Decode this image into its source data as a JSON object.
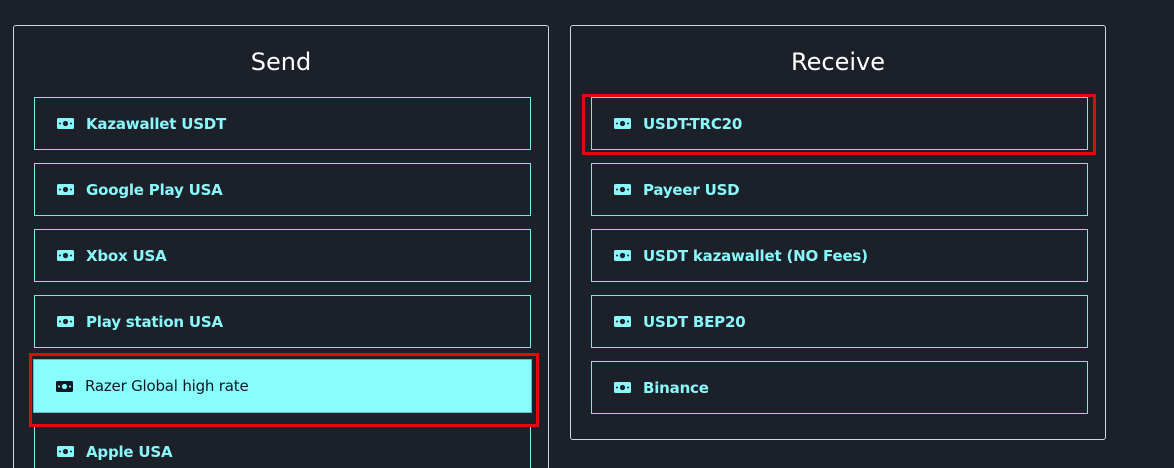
{
  "send": {
    "title": "Send",
    "items": [
      {
        "label": "Kazawallet USDT",
        "selected": false
      },
      {
        "label": "Google Play USA",
        "selected": false
      },
      {
        "label": "Xbox USA",
        "selected": false
      },
      {
        "label": "Play station USA",
        "selected": false
      },
      {
        "label": "Razer Global high rate",
        "selected": true
      },
      {
        "label": "Apple USA",
        "selected": false
      }
    ]
  },
  "receive": {
    "title": "Receive",
    "items": [
      {
        "label": "USDT-TRC20",
        "selected": false
      },
      {
        "label": "Payeer USD",
        "selected": false
      },
      {
        "label": "USDT kazawallet (NO Fees)",
        "selected": false
      },
      {
        "label": "USDT BEP20",
        "selected": false
      },
      {
        "label": "Binance",
        "selected": false
      }
    ]
  },
  "icons": {
    "item_icon": "money-bill-icon"
  },
  "colors": {
    "background": "#1b2029",
    "accent": "#88fdfc",
    "highlight": "#e00b0b"
  }
}
